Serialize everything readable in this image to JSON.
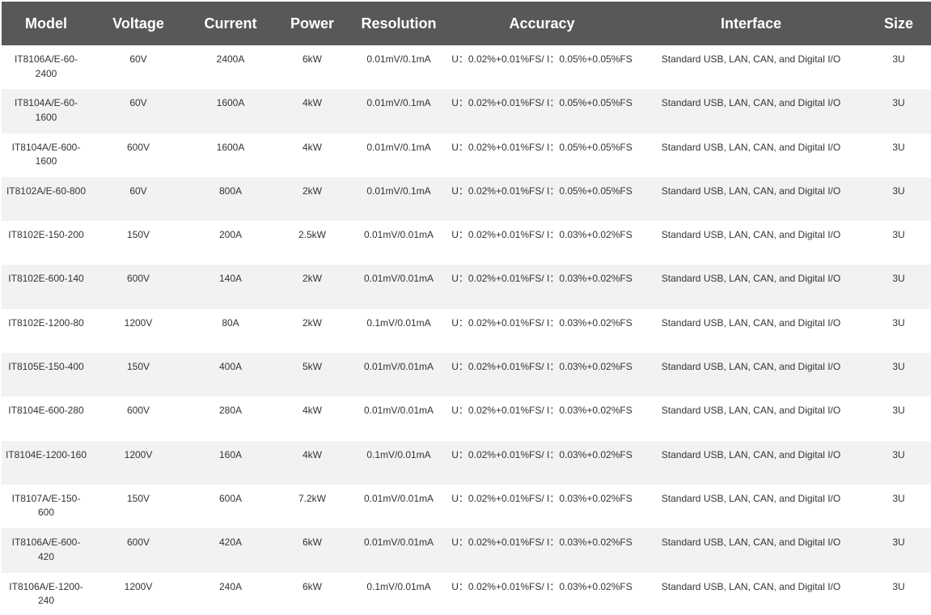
{
  "table": {
    "headers": [
      "Model",
      "Voltage",
      "Current",
      "Power",
      "Resolution",
      "Accuracy",
      "Interface",
      "Size"
    ],
    "rows": [
      {
        "model": "IT8106A/E-60-2400",
        "voltage": "60V",
        "current": "2400A",
        "power": "6kW",
        "resolution": "0.01mV/0.1mA",
        "accuracy": "U：0.02%+0.01%FS/ I：0.05%+0.05%FS",
        "interface": "Standard USB, LAN, CAN, and Digital I/O",
        "size": "3U"
      },
      {
        "model": "IT8104A/E-60-1600",
        "voltage": "60V",
        "current": "1600A",
        "power": "4kW",
        "resolution": "0.01mV/0.1mA",
        "accuracy": "U：0.02%+0.01%FS/ I：0.05%+0.05%FS",
        "interface": "Standard USB, LAN, CAN, and Digital I/O",
        "size": "3U"
      },
      {
        "model": "IT8104A/E-600-1600",
        "voltage": "600V",
        "current": "1600A",
        "power": "4kW",
        "resolution": "0.01mV/0.1mA",
        "accuracy": "U：0.02%+0.01%FS/ I：0.05%+0.05%FS",
        "interface": "Standard USB, LAN, CAN, and Digital I/O",
        "size": "3U"
      },
      {
        "model": "IT8102A/E-60-800",
        "voltage": "60V",
        "current": "800A",
        "power": "2kW",
        "resolution": "0.01mV/0.1mA",
        "accuracy": "U：0.02%+0.01%FS/ I：0.05%+0.05%FS",
        "interface": "Standard USB, LAN, CAN, and Digital I/O",
        "size": "3U"
      },
      {
        "model": "IT8102E-150-200",
        "voltage": "150V",
        "current": "200A",
        "power": "2.5kW",
        "resolution": "0.01mV/0.01mA",
        "accuracy": "U：0.02%+0.01%FS/ I：0.03%+0.02%FS",
        "interface": "Standard USB, LAN, CAN, and Digital I/O",
        "size": "3U"
      },
      {
        "model": "IT8102E-600-140",
        "voltage": "600V",
        "current": "140A",
        "power": "2kW",
        "resolution": "0.01mV/0.01mA",
        "accuracy": "U：0.02%+0.01%FS/ I：0.03%+0.02%FS",
        "interface": "Standard USB, LAN, CAN, and Digital I/O",
        "size": "3U"
      },
      {
        "model": "IT8102E-1200-80",
        "voltage": "1200V",
        "current": "80A",
        "power": "2kW",
        "resolution": "0.1mV/0.01mA",
        "accuracy": "U：0.02%+0.01%FS/ I：0.03%+0.02%FS",
        "interface": "Standard USB, LAN, CAN, and Digital I/O",
        "size": "3U"
      },
      {
        "model": "IT8105E-150-400",
        "voltage": "150V",
        "current": "400A",
        "power": "5kW",
        "resolution": "0.01mV/0.01mA",
        "accuracy": "U：0.02%+0.01%FS/ I：0.03%+0.02%FS",
        "interface": "Standard USB, LAN, CAN, and Digital I/O",
        "size": "3U"
      },
      {
        "model": "IT8104E-600-280",
        "voltage": "600V",
        "current": "280A",
        "power": "4kW",
        "resolution": "0.01mV/0.01mA",
        "accuracy": "U：0.02%+0.01%FS/ I：0.03%+0.02%FS",
        "interface": "Standard USB, LAN, CAN, and Digital I/O",
        "size": "3U"
      },
      {
        "model": "IT8104E-1200-160",
        "voltage": "1200V",
        "current": "160A",
        "power": "4kW",
        "resolution": "0.1mV/0.01mA",
        "accuracy": "U：0.02%+0.01%FS/ I：0.03%+0.02%FS",
        "interface": "Standard USB, LAN, CAN, and Digital I/O",
        "size": "3U"
      },
      {
        "model": "IT8107A/E-150-600",
        "voltage": "150V",
        "current": "600A",
        "power": "7.2kW",
        "resolution": "0.01mV/0.01mA",
        "accuracy": "U：0.02%+0.01%FS/ I：0.03%+0.02%FS",
        "interface": "Standard USB, LAN, CAN, and Digital I/O",
        "size": "3U"
      },
      {
        "model": "IT8106A/E-600-420",
        "voltage": "600V",
        "current": "420A",
        "power": "6kW",
        "resolution": "0.01mV/0.01mA",
        "accuracy": "U：0.02%+0.01%FS/ I：0.03%+0.02%FS",
        "interface": "Standard USB, LAN, CAN, and Digital I/O",
        "size": "3U"
      },
      {
        "model": "IT8106A/E-1200-240",
        "voltage": "1200V",
        "current": "240A",
        "power": "6kW",
        "resolution": "0.1mV/0.01mA",
        "accuracy": "U：0.02%+0.01%FS/ I：0.03%+0.02%FS",
        "interface": "Standard USB, LAN, CAN, and Digital I/O",
        "size": "3U"
      }
    ]
  },
  "colors": {
    "header_bg": "#595757",
    "header_text": "#ffffff",
    "row_alt_bg": "#f2f2f2",
    "cell_text": "#333333"
  }
}
